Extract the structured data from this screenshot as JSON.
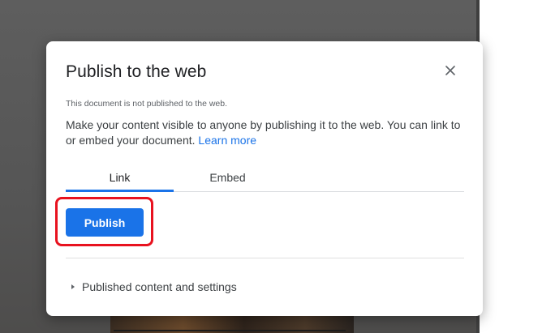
{
  "dialog": {
    "title": "Publish to the web",
    "close_icon": "close-icon",
    "status_note": "This document is not published to the web.",
    "description": "Make your content visible to anyone by publishing it to the web. You can link to or embed your document.",
    "learn_more": "Learn more",
    "tabs": [
      {
        "label": "Link",
        "selected": true
      },
      {
        "label": "Embed",
        "selected": false
      }
    ],
    "publish_button": "Publish",
    "expander_icon": "caret-right-icon",
    "expander_label": "Published content and settings"
  },
  "colors": {
    "accent": "#1a73e8",
    "highlight": "#e8121f",
    "backdrop": "#5e5e5e"
  }
}
